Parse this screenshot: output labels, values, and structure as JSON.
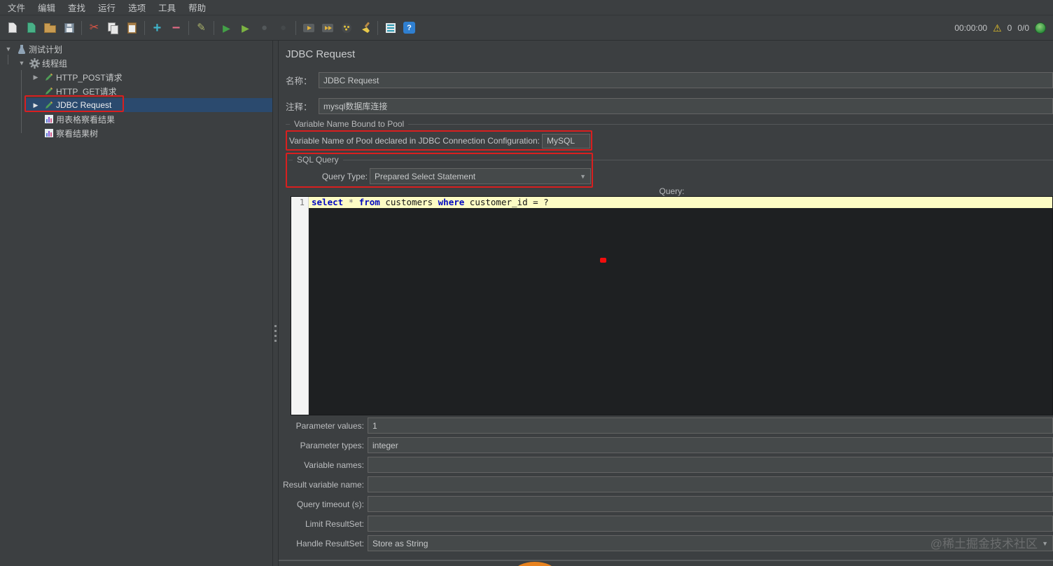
{
  "menubar": {
    "items": [
      "文件",
      "编辑",
      "查找",
      "运行",
      "选项",
      "工具",
      "帮助"
    ]
  },
  "toolbar": {
    "icons": [
      "new-file",
      "templates",
      "open-file",
      "save",
      "cut",
      "copy",
      "paste",
      "add",
      "remove",
      "pencil",
      "start",
      "start-no-pauses",
      "stop",
      "shutdown",
      "remote-start",
      "remote-start-all",
      "clear",
      "clear-all",
      "function-helper",
      "help",
      "warning",
      "globe"
    ],
    "elapsed_time": "00:00:00",
    "error_count": "0",
    "thread_count": "0/0"
  },
  "tree": {
    "items": [
      {
        "label": "测试计划"
      },
      {
        "label": "线程组"
      },
      {
        "label": "HTTP_POST请求"
      },
      {
        "label": "HTTP_GET请求"
      },
      {
        "label": "JDBC Request"
      },
      {
        "label": "用表格察看结果"
      },
      {
        "label": "察看结果树"
      }
    ]
  },
  "panel": {
    "title": "JDBC Request",
    "name_label": "名称：",
    "name_value": "JDBC Request",
    "comment_label": "注释：",
    "comment_value": "mysql数据库连接",
    "pool_group": {
      "title": "Variable Name Bound to Pool",
      "pool_label": "Variable Name of Pool declared in JDBC Connection Configuration:",
      "pool_value": "MySQL"
    },
    "sql_group": {
      "title": "SQL Query",
      "query_type_label": "Query Type:",
      "query_type_value": "Prepared Select Statement",
      "query_label": "Query:",
      "editor": {
        "line_number": "1",
        "tokens": [
          "select",
          " * ",
          "from",
          " customers ",
          "where",
          " customer_id = ?"
        ]
      }
    },
    "fields": [
      {
        "label": "Parameter values:",
        "value": "1"
      },
      {
        "label": "Parameter types:",
        "value": "integer"
      },
      {
        "label": "Variable names:",
        "value": ""
      },
      {
        "label": "Result variable name:",
        "value": ""
      },
      {
        "label": "Query timeout (s):",
        "value": ""
      },
      {
        "label": "Limit ResultSet:",
        "value": ""
      },
      {
        "label": "Handle ResultSet:",
        "value": "Store as String"
      }
    ]
  },
  "watermark": "@稀土掘金技术社区",
  "colors": {
    "background": "#3c3f41",
    "tree_selection": "#2b4a6e",
    "annotation_red": "#d91f1f",
    "editor_current_line": "#fdfcc4",
    "field_background": "#45494a"
  }
}
